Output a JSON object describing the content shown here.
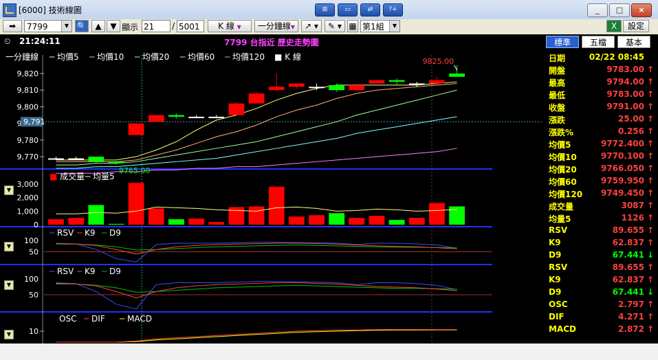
{
  "window": {
    "title": "[6000] 技術線圖",
    "min": "_",
    "max": "□",
    "close": "×"
  },
  "toolbar": {
    "code": "7799",
    "display_label": "顯示",
    "display_from": "21",
    "display_sep": "/",
    "display_to": "5001",
    "chart_type": "K 線",
    "period": "一分鐘線",
    "group": "第1組",
    "settings": "設定"
  },
  "chart": {
    "time": "21:24:11",
    "title": "7799 台指近  歷史走勢圖",
    "legend": [
      "一分鐘線",
      "均價5",
      "均價10",
      "均價20",
      "均價60",
      "均價120",
      "K 線"
    ],
    "volume_legend": [
      "成交量",
      "均量5"
    ],
    "kd1_legend": [
      "RSV",
      "K9",
      "D9"
    ],
    "kd2_legend": [
      "RSV",
      "K9",
      "D9"
    ],
    "macd_legend": [
      "OSC",
      "DIF",
      "MACD"
    ],
    "high_label": "9825.00",
    "low_label": "9765.00",
    "crosshair_label": "9,791",
    "price_ticks": [
      "9,820",
      "9,810",
      "9,800",
      "9,790",
      "9,780",
      "9,770"
    ],
    "volume_ticks": [
      "3,000",
      "2,000",
      "1,000",
      "0"
    ],
    "kd_ticks": [
      "100",
      "50"
    ],
    "macd_ticks": [
      "10"
    ]
  },
  "chart_data": {
    "type": "candlestick",
    "ylim": [
      9763,
      9827
    ],
    "candles": [
      {
        "o": 9769,
        "h": 9770,
        "l": 9768,
        "c": 9769
      },
      {
        "o": 9769,
        "h": 9770,
        "l": 9768,
        "c": 9769
      },
      {
        "o": 9770,
        "h": 9770,
        "l": 9766,
        "c": 9767
      },
      {
        "o": 9767,
        "h": 9767,
        "l": 9765,
        "c": 9766
      },
      {
        "o": 9783,
        "h": 9790,
        "l": 9783,
        "c": 9790
      },
      {
        "o": 9791,
        "h": 9795,
        "l": 9791,
        "c": 9795
      },
      {
        "o": 9795,
        "h": 9796,
        "l": 9793,
        "c": 9794
      },
      {
        "o": 9794,
        "h": 9795,
        "l": 9793,
        "c": 9794
      },
      {
        "o": 9794,
        "h": 9795,
        "l": 9793,
        "c": 9794
      },
      {
        "o": 9795,
        "h": 9803,
        "l": 9795,
        "c": 9802
      },
      {
        "o": 9802,
        "h": 9809,
        "l": 9802,
        "c": 9808
      },
      {
        "o": 9810,
        "h": 9820,
        "l": 9809,
        "c": 9812
      },
      {
        "o": 9812,
        "h": 9814,
        "l": 9811,
        "c": 9814
      },
      {
        "o": 9812,
        "h": 9814,
        "l": 9810,
        "c": 9812
      },
      {
        "o": 9813,
        "h": 9814,
        "l": 9809,
        "c": 9810
      },
      {
        "o": 9810,
        "h": 9814,
        "l": 9809,
        "c": 9813
      },
      {
        "o": 9814,
        "h": 9816,
        "l": 9814,
        "c": 9816
      },
      {
        "o": 9816,
        "h": 9817,
        "l": 9813,
        "c": 9815
      },
      {
        "o": 9814,
        "h": 9815,
        "l": 9812,
        "c": 9814
      },
      {
        "o": 9814,
        "h": 9818,
        "l": 9813,
        "c": 9816
      },
      {
        "o": 9820,
        "h": 9825,
        "l": 9819,
        "c": 9818
      }
    ],
    "volume": [
      400,
      500,
      1450,
      60,
      3087,
      1200,
      400,
      450,
      200,
      1300,
      1350,
      2800,
      600,
      700,
      850,
      500,
      650,
      350,
      500,
      1600,
      1350
    ],
    "volume_ylim": [
      0,
      3200
    ],
    "ma5": [
      9768,
      9768,
      9768,
      9768,
      9770,
      9774,
      9779,
      9786,
      9792,
      9795,
      9799,
      9804,
      9808,
      9811,
      9813,
      9813,
      9813,
      9813,
      9813,
      9814,
      9815
    ],
    "ma10": [
      9767,
      9767,
      9767,
      9767,
      9768,
      9771,
      9774,
      9778,
      9782,
      9785,
      9789,
      9794,
      9798,
      9801,
      9805,
      9808,
      9810,
      9811,
      9812,
      9813,
      9814
    ],
    "ma20": [
      9765,
      9765,
      9766,
      9766,
      9767,
      9769,
      9771,
      9773,
      9775,
      9777,
      9779,
      9782,
      9785,
      9788,
      9791,
      9795,
      9798,
      9801,
      9804,
      9807,
      9810
    ],
    "ma60": [
      9763,
      9763,
      9764,
      9764,
      9765,
      9766,
      9767,
      9768,
      9769,
      9771,
      9773,
      9775,
      9777,
      9779,
      9781,
      9784,
      9786,
      9788,
      9790,
      9792,
      9794
    ],
    "ma120": [
      9760,
      9760,
      9760,
      9761,
      9761,
      9762,
      9762,
      9763,
      9763,
      9764,
      9764,
      9765,
      9766,
      9767,
      9768,
      9769,
      9770,
      9771,
      9772,
      9773,
      9775
    ],
    "vol_ma5": [
      800,
      800,
      900,
      850,
      1000,
      1300,
      1250,
      1200,
      1100,
      1050,
      1000,
      1250,
      1300,
      1200,
      1000,
      1050,
      1150,
      1100,
      1000,
      1050,
      1126
    ],
    "kd_ylim": [
      0,
      100
    ],
    "rsv": [
      88,
      85,
      60,
      20,
      5,
      82,
      88,
      88,
      88,
      90,
      92,
      92,
      91,
      90,
      88,
      82,
      88,
      88,
      85,
      80,
      66
    ],
    "k9": [
      86,
      84,
      78,
      60,
      40,
      60,
      72,
      78,
      82,
      84,
      86,
      88,
      88,
      86,
      84,
      80,
      76,
      74,
      72,
      68,
      62.837
    ],
    "d9": [
      84,
      84,
      80,
      72,
      58,
      60,
      64,
      68,
      72,
      74,
      76,
      78,
      80,
      78,
      76,
      74,
      72,
      70,
      70,
      69,
      67.441
    ]
  },
  "colors": {
    "up": "#ff0000",
    "down": "#00ff00",
    "ma5": "#ffff80",
    "ma10": "#ffb080",
    "ma20": "#80ffff",
    "ma60": "#80ffff",
    "ma120": "#ff80ff"
  },
  "panel": {
    "tabs": [
      "標準",
      "五檔",
      "基本"
    ],
    "rows": [
      {
        "label": "日期",
        "value": "02/22 08:45",
        "arrow": "",
        "color": "#ffff00"
      },
      {
        "label": "開盤",
        "value": "9783.00",
        "arrow": "↑",
        "color": "#ff4040"
      },
      {
        "label": "最高",
        "value": "9794.00",
        "arrow": "↑",
        "color": "#ff4040"
      },
      {
        "label": "最低",
        "value": "9783.00",
        "arrow": "↑",
        "color": "#ff4040"
      },
      {
        "label": "收盤",
        "value": "9791.00",
        "arrow": "↑",
        "color": "#ff4040"
      },
      {
        "label": "漲跌",
        "value": "25.00",
        "arrow": "↑",
        "color": "#ff4040"
      },
      {
        "label": "漲跌%",
        "value": "0.256",
        "arrow": "↑",
        "color": "#ff4040"
      },
      {
        "label": "均價5",
        "value": "9772.400",
        "arrow": "↑",
        "color": "#ff4040"
      },
      {
        "label": "均價10",
        "value": "9770.100",
        "arrow": "↑",
        "color": "#ff4040"
      },
      {
        "label": "均價20",
        "value": "9766.050",
        "arrow": "↑",
        "color": "#ff4040"
      },
      {
        "label": "均價60",
        "value": "9759.950",
        "arrow": "↑",
        "color": "#ff4040"
      },
      {
        "label": "均價120",
        "value": "9749.450",
        "arrow": "↑",
        "color": "#ff4040"
      },
      {
        "label": "成交量",
        "value": "3087",
        "arrow": "↑",
        "color": "#ff4040"
      },
      {
        "label": "均量5",
        "value": "1126",
        "arrow": "↑",
        "color": "#ff4040"
      },
      {
        "label": "RSV",
        "value": "89.655",
        "arrow": "↑",
        "color": "#ff4040"
      },
      {
        "label": "K9",
        "value": "62.837",
        "arrow": "↑",
        "color": "#ff4040"
      },
      {
        "label": "D9",
        "value": "67.441",
        "arrow": "↓",
        "color": "#00ff00"
      },
      {
        "label": "RSV",
        "value": "89.655",
        "arrow": "↑",
        "color": "#ff4040"
      },
      {
        "label": "K9",
        "value": "62.837",
        "arrow": "↑",
        "color": "#ff4040"
      },
      {
        "label": "D9",
        "value": "67.441",
        "arrow": "↓",
        "color": "#00ff00"
      },
      {
        "label": "OSC",
        "value": "2.797",
        "arrow": "↑",
        "color": "#ff4040"
      },
      {
        "label": "DIF",
        "value": "4.271",
        "arrow": "↑",
        "color": "#ff4040"
      },
      {
        "label": "MACD",
        "value": "2.872",
        "arrow": "↑",
        "color": "#ff4040"
      }
    ]
  }
}
